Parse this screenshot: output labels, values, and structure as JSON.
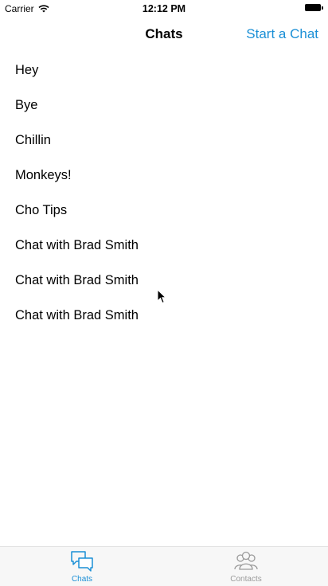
{
  "status_bar": {
    "carrier": "Carrier",
    "time": "12:12 PM"
  },
  "nav": {
    "title": "Chats",
    "action_label": "Start a Chat"
  },
  "chats": [
    {
      "title": "Hey"
    },
    {
      "title": "Bye"
    },
    {
      "title": "Chillin"
    },
    {
      "title": "Monkeys!"
    },
    {
      "title": "Cho Tips"
    },
    {
      "title": "Chat with Brad Smith"
    },
    {
      "title": "Chat with Brad Smith"
    },
    {
      "title": "Chat with Brad Smith"
    }
  ],
  "tabs": [
    {
      "label": "Chats",
      "icon": "chat-bubbles-icon",
      "active": true
    },
    {
      "label": "Contacts",
      "icon": "contacts-icon",
      "active": false
    }
  ],
  "colors": {
    "accent": "#1a8fd6",
    "inactive_tab": "#9a9a9a",
    "tab_bar_bg": "#f7f7f7"
  }
}
